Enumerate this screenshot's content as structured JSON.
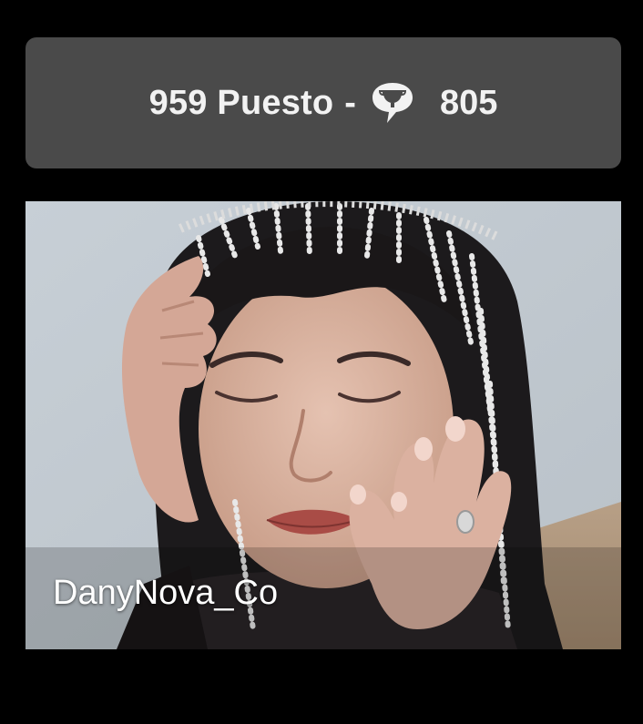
{
  "rank_card": {
    "rank_label": "959 Puesto",
    "separator": "-",
    "icon": "trophy-chat-icon",
    "score": "805"
  },
  "profile": {
    "username": "DanyNova_Co",
    "photo_description_icon": "profile-photo"
  },
  "colors": {
    "background": "#000000",
    "card": "#4a4a4a",
    "text": "#f2f2f2"
  }
}
